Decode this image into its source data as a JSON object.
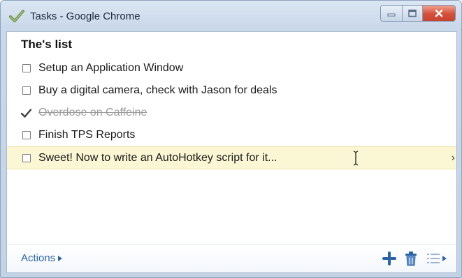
{
  "window": {
    "title": "Tasks - Google Chrome"
  },
  "list": {
    "title": "The's list",
    "tasks": [
      {
        "text": "Setup an Application Window",
        "done": false
      },
      {
        "text": "Buy a digital camera, check with Jason for deals",
        "done": false
      },
      {
        "text": "Overdose on Caffeine",
        "done": true
      },
      {
        "text": "Finish TPS Reports",
        "done": false
      },
      {
        "text": "Sweet! Now to write an AutoHotkey script for it...",
        "done": false,
        "highlighted": true
      }
    ]
  },
  "footer": {
    "actions_label": "Actions"
  },
  "icons": {
    "app": "checkmark-icon",
    "add": "plus-icon",
    "delete": "trash-icon",
    "lists": "list-icon"
  },
  "colors": {
    "accent": "#2a64a8",
    "highlight_row": "#fbf6d3",
    "close_button": "#d4503a"
  }
}
